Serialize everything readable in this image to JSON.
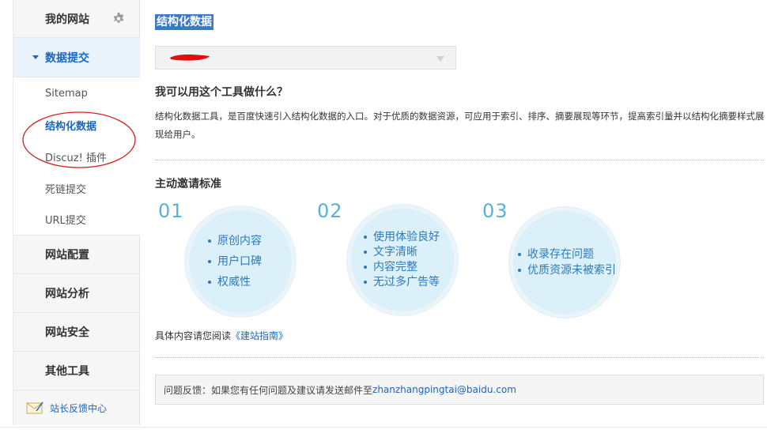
{
  "sidebar": {
    "header_label": "我的网站",
    "header_icon": "gear-icon",
    "active_section": "数据提交",
    "sub_items": [
      {
        "label": "Sitemap"
      },
      {
        "label": "结构化数据"
      },
      {
        "label": "Discuz! 插件"
      },
      {
        "label": "死链提交"
      },
      {
        "label": "URL提交"
      }
    ],
    "groups": [
      {
        "label": "网站配置"
      },
      {
        "label": "网站分析"
      },
      {
        "label": "网站安全"
      },
      {
        "label": "其他工具"
      }
    ],
    "feedback_label": "站长反馈中心",
    "feedback_icon": "mail-icon"
  },
  "main": {
    "title": "结构化数据",
    "select_arrow_icon": "chevron-down-icon",
    "question_heading": "我可以用这个工具做什么？",
    "description": "结构化数据工具，是百度快速引入结构化数据的入口。对于优质的数据资源，可应用于索引、排序、摘要展现等环节，提高索引量并以结构化摘要样式展现给用户。",
    "standard_heading": "主动邀请标准",
    "criteria": [
      {
        "number": "01",
        "items": [
          "原创内容",
          "用户口碑",
          "权威性"
        ]
      },
      {
        "number": "02",
        "items": [
          "使用体验良好",
          "文字清晰",
          "内容完整",
          "无过多广告等"
        ]
      },
      {
        "number": "03",
        "items": [
          "收录存在问题",
          "优质资源未被索引"
        ]
      }
    ],
    "guide_prefix": "具体内容请您阅读",
    "guide_link": "《建站指南》",
    "feedback_prefix": "问题反馈：如果您有任何问题及建议请发送邮件至",
    "feedback_email": "zhanzhangpingtai@baidu.com"
  },
  "colors": {
    "accent_blue": "#1a66c0",
    "title_highlight": "#3a78c9",
    "circle_fill": "#dcf0f9",
    "number_blue": "#58b1d9",
    "annotation_red": "#d42020"
  }
}
